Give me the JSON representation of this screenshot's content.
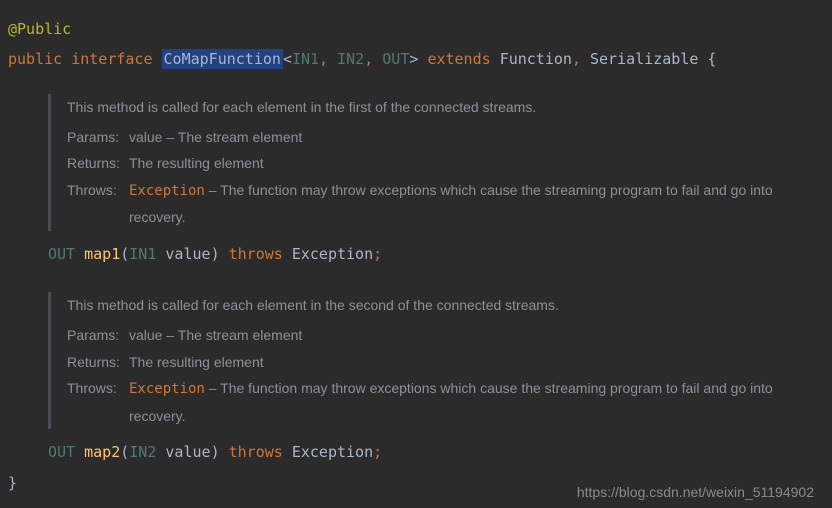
{
  "code": {
    "annotation": "@Public",
    "modifier1": "public",
    "modifier2": "interface",
    "className": "CoMapFunction",
    "lt": "<",
    "gt": ">",
    "typeParam1": "IN1",
    "typeParam2": "IN2",
    "typeParam3": "OUT",
    "comma": ", ",
    "extends": "extends",
    "super1": "Function",
    "super2": "Serializable",
    "openBrace": " {",
    "closeBrace": "}",
    "commaSpace": ", "
  },
  "doc1": {
    "description": "This method is called for each element in the first of the connected streams.",
    "paramsLabel": "Params:",
    "paramsValue": "value – The stream element",
    "returnsLabel": "Returns:",
    "returnsValue": "The resulting element",
    "throwsLabel": "Throws:",
    "throwsCode": "Exception",
    "throwsRest": " – The function may throw exceptions which cause the streaming program to fail and go into recovery."
  },
  "method1": {
    "returnType": "OUT",
    "name": "map1",
    "open": "(",
    "paramType": "IN1",
    "paramName": " value",
    "close": ") ",
    "throws": "throws",
    "exception": " Exception",
    "semi": ";"
  },
  "doc2": {
    "description": "This method is called for each element in the second of the connected streams.",
    "paramsLabel": "Params:",
    "paramsValue": "value – The stream element",
    "returnsLabel": "Returns:",
    "returnsValue": "The resulting element",
    "throwsLabel": "Throws:",
    "throwsCode": "Exception",
    "throwsRest": " – The function may throw exceptions which cause the streaming program to fail and go into recovery."
  },
  "method2": {
    "returnType": "OUT",
    "name": "map2",
    "open": "(",
    "paramType": "IN2",
    "paramName": " value",
    "close": ") ",
    "throws": "throws",
    "exception": " Exception",
    "semi": ";"
  },
  "watermark": "https://blog.csdn.net/weixin_51194902"
}
